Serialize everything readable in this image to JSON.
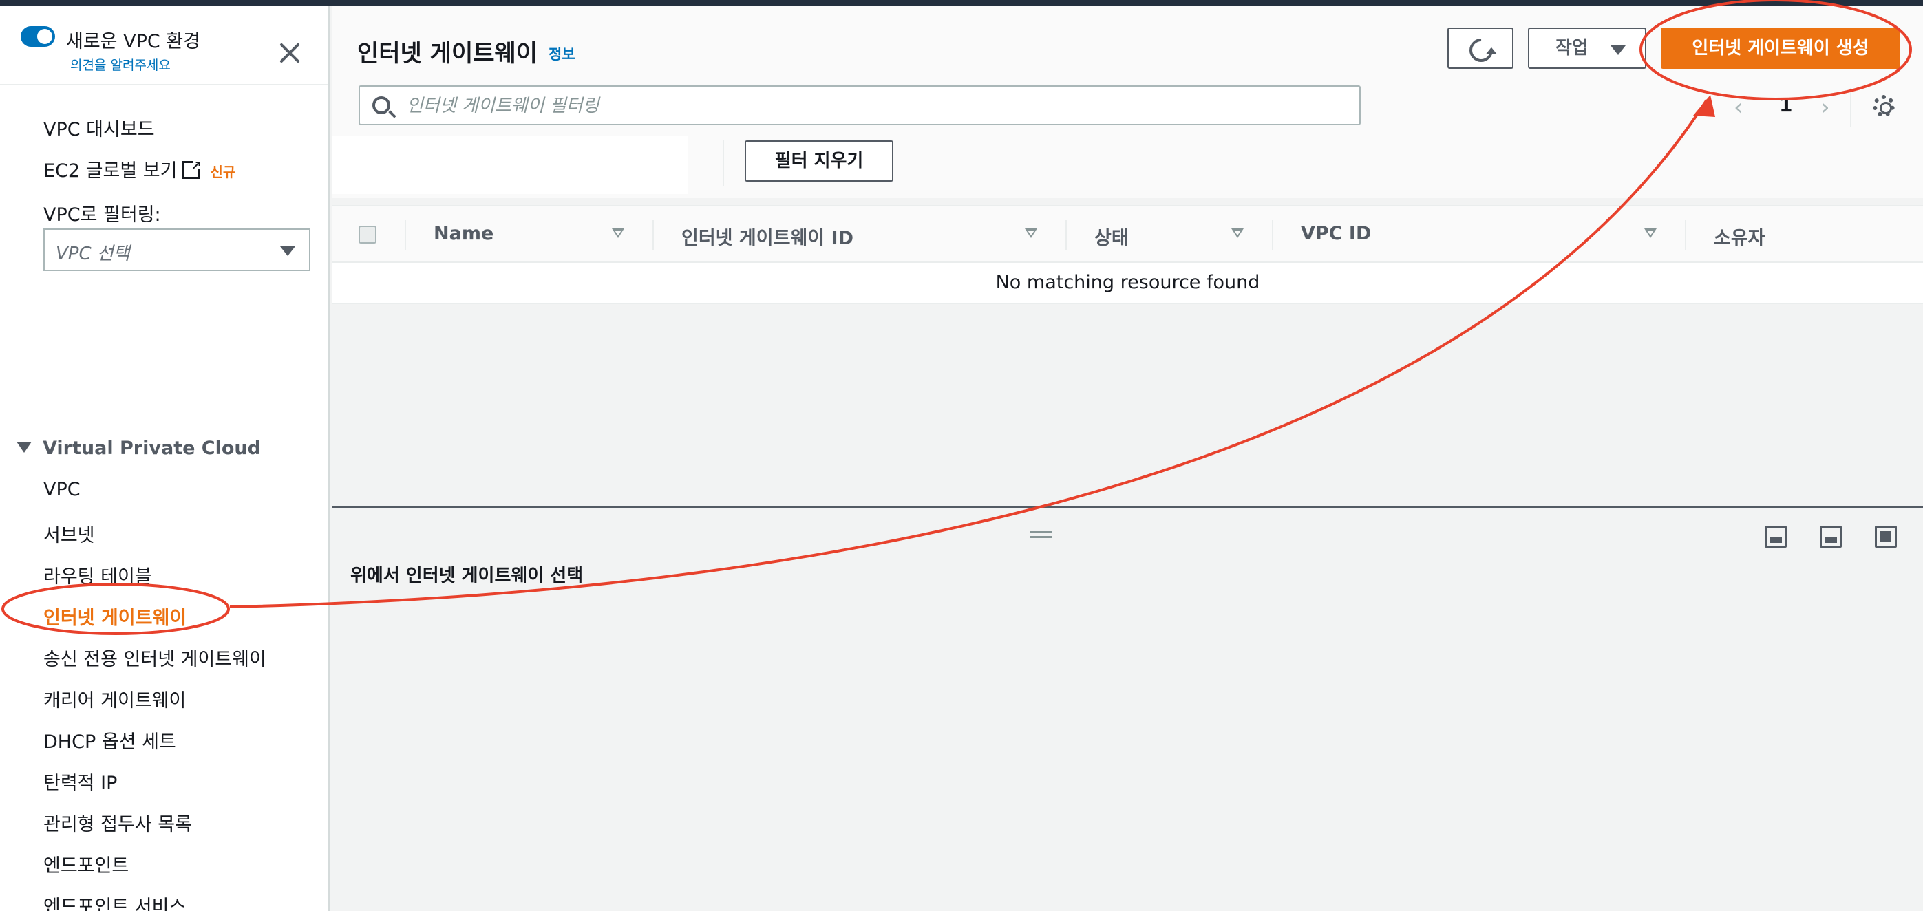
{
  "sidebar": {
    "toggle_label": "새로운 VPC 환경",
    "feedback_link": "의견을 알려주세요",
    "top_items": [
      {
        "label": "VPC 대시보드"
      },
      {
        "label": "EC2 글로벌 보기",
        "badge": "신규"
      }
    ],
    "filter_label": "VPC로 필터링:",
    "filter_select_placeholder": "VPC 선택",
    "section_title": "Virtual Private Cloud",
    "items": [
      {
        "label": "VPC"
      },
      {
        "label": "서브넷"
      },
      {
        "label": "라우팅 테이블"
      },
      {
        "label": "인터넷 게이트웨이",
        "active": true
      },
      {
        "label": "송신 전용 인터넷 게이트웨이"
      },
      {
        "label": "캐리어 게이트웨이"
      },
      {
        "label": "DHCP 옵션 세트"
      },
      {
        "label": "탄력적 IP"
      },
      {
        "label": "관리형 접두사 목록"
      },
      {
        "label": "엔드포인트"
      },
      {
        "label": "엔드포인트 서비스"
      }
    ]
  },
  "header": {
    "title": "인터넷 게이트웨이",
    "info_link": "정보",
    "actions_label": "작업",
    "create_label": "인터넷 게이트웨이 생성"
  },
  "search": {
    "placeholder": "인터넷 게이트웨이 필터링",
    "value": ""
  },
  "pagination": {
    "current_page": "1"
  },
  "filter": {
    "clear_label": "필터 지우기"
  },
  "table": {
    "columns": [
      "Name",
      "인터넷 게이트웨이 ID",
      "상태",
      "VPC ID",
      "소유자"
    ],
    "empty_message": "No matching resource found"
  },
  "detail": {
    "title": "위에서 인터넷 게이트웨이 선택"
  },
  "colors": {
    "accent": "#ec7211",
    "link": "#0073bb",
    "annotation": "#e8412c"
  },
  "icons": [
    "close-icon",
    "external-link-icon",
    "refresh-icon",
    "search-icon",
    "gear-icon",
    "chevron-left-icon",
    "chevron-right-icon",
    "sort-icon"
  ]
}
